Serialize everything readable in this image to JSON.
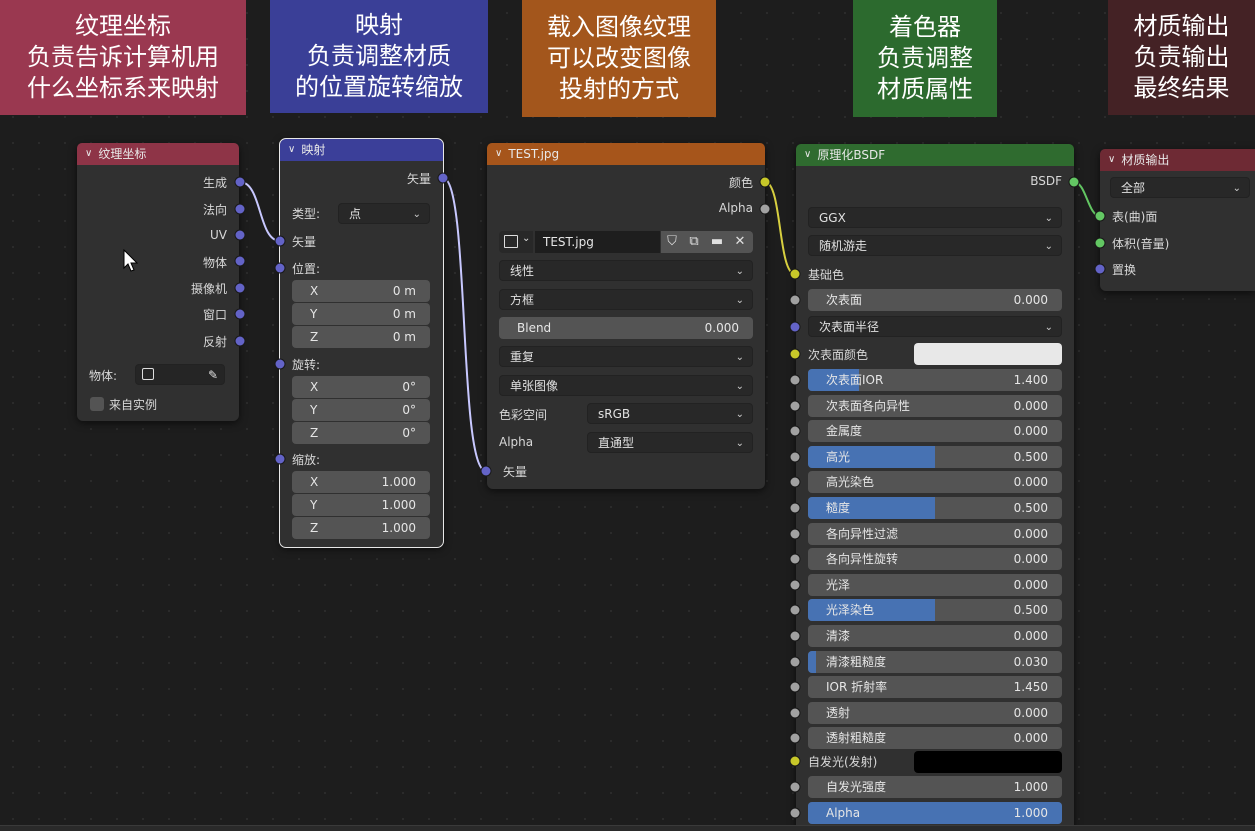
{
  "banners": [
    {
      "lines": [
        "纹理坐标",
        "负责告诉计算机用",
        "什么坐标系来映射"
      ],
      "color": "#9a3850"
    },
    {
      "lines": [
        "映射",
        "负责调整材质",
        "的位置旋转缩放"
      ],
      "color": "#3a3f97"
    },
    {
      "lines": [
        "载入图像纹理",
        "可以改变图像",
        "投射的方式"
      ],
      "color": "#a3561c"
    },
    {
      "lines": [
        "着色器",
        "负责调整",
        "材质属性"
      ],
      "color": "#2c6a2e"
    },
    {
      "lines": [
        "材质输出",
        "负责输出",
        "最终结果"
      ],
      "color": "#442225"
    }
  ],
  "texcoord": {
    "title": "纹理坐标",
    "outputs": [
      "生成",
      "法向",
      "UV",
      "物体",
      "摄像机",
      "窗口",
      "反射"
    ],
    "object_label": "物体:",
    "instancer_label": "来自实例"
  },
  "mapping": {
    "title": "映射",
    "output": "矢量",
    "type_label": "类型:",
    "type_value": "点",
    "input_vector": "矢量",
    "location_label": "位置:",
    "location": [
      {
        "axis": "X",
        "value": "0 m"
      },
      {
        "axis": "Y",
        "value": "0 m"
      },
      {
        "axis": "Z",
        "value": "0 m"
      }
    ],
    "rotation_label": "旋转:",
    "rotation": [
      {
        "axis": "X",
        "value": "0°"
      },
      {
        "axis": "Y",
        "value": "0°"
      },
      {
        "axis": "Z",
        "value": "0°"
      }
    ],
    "scale_label": "缩放:",
    "scale": [
      {
        "axis": "X",
        "value": "1.000"
      },
      {
        "axis": "Y",
        "value": "1.000"
      },
      {
        "axis": "Z",
        "value": "1.000"
      }
    ]
  },
  "image": {
    "title": "TEST.jpg",
    "out_color": "颜色",
    "out_alpha": "Alpha",
    "image_name": "TEST.jpg",
    "interpolation": "线性",
    "projection": "方框",
    "blend_label": "Blend",
    "blend_value": "0.000",
    "extension": "重复",
    "source": "单张图像",
    "colorspace_label": "色彩空间",
    "colorspace_value": "sRGB",
    "alpha_label": "Alpha",
    "alpha_value": "直通型",
    "input_vector": "矢量"
  },
  "bsdf": {
    "title": "原理化BSDF",
    "output": "BSDF",
    "distribution": "GGX",
    "subsurface_method": "随机游走",
    "base_color_label": "基础色",
    "subsurface": {
      "label": "次表面",
      "value": "0.000"
    },
    "subsurface_radius": "次表面半径",
    "subsurface_color_label": "次表面颜色",
    "subsurface_color": "#e8e8e8",
    "params": [
      {
        "label": "次表面IOR",
        "value": "1.400",
        "fill": 0.2
      },
      {
        "label": "次表面各向异性",
        "value": "0.000",
        "fill": 0
      },
      {
        "label": "金属度",
        "value": "0.000",
        "fill": 0
      },
      {
        "label": "高光",
        "value": "0.500",
        "fill": 0.5
      },
      {
        "label": "高光染色",
        "value": "0.000",
        "fill": 0
      },
      {
        "label": "糙度",
        "value": "0.500",
        "fill": 0.5
      },
      {
        "label": "各向异性过滤",
        "value": "0.000",
        "fill": 0
      },
      {
        "label": "各向异性旋转",
        "value": "0.000",
        "fill": 0
      },
      {
        "label": "光泽",
        "value": "0.000",
        "fill": 0
      },
      {
        "label": "光泽染色",
        "value": "0.500",
        "fill": 0.5
      },
      {
        "label": "清漆",
        "value": "0.000",
        "fill": 0
      },
      {
        "label": "清漆粗糙度",
        "value": "0.030",
        "fill": 0.03
      },
      {
        "label": "IOR 折射率",
        "value": "1.450",
        "fill": 0
      },
      {
        "label": "透射",
        "value": "0.000",
        "fill": 0
      },
      {
        "label": "透射粗糙度",
        "value": "0.000",
        "fill": 0
      }
    ],
    "emission_label": "自发光(发射)",
    "emission_color": "#000000",
    "emission_strength": {
      "label": "自发光强度",
      "value": "1.000"
    },
    "alpha": {
      "label": "Alpha",
      "value": "1.000",
      "fill": 1.0
    }
  },
  "output": {
    "title": "材质输出",
    "target": "全部",
    "inputs": [
      "表(曲)面",
      "体积(音量)",
      "置换"
    ]
  },
  "colors": {
    "accent": "#4772b3",
    "vector_socket": "#6363c7",
    "color_socket": "#c7c729",
    "value_socket": "#a1a1a1",
    "shader_socket": "#63c763"
  }
}
